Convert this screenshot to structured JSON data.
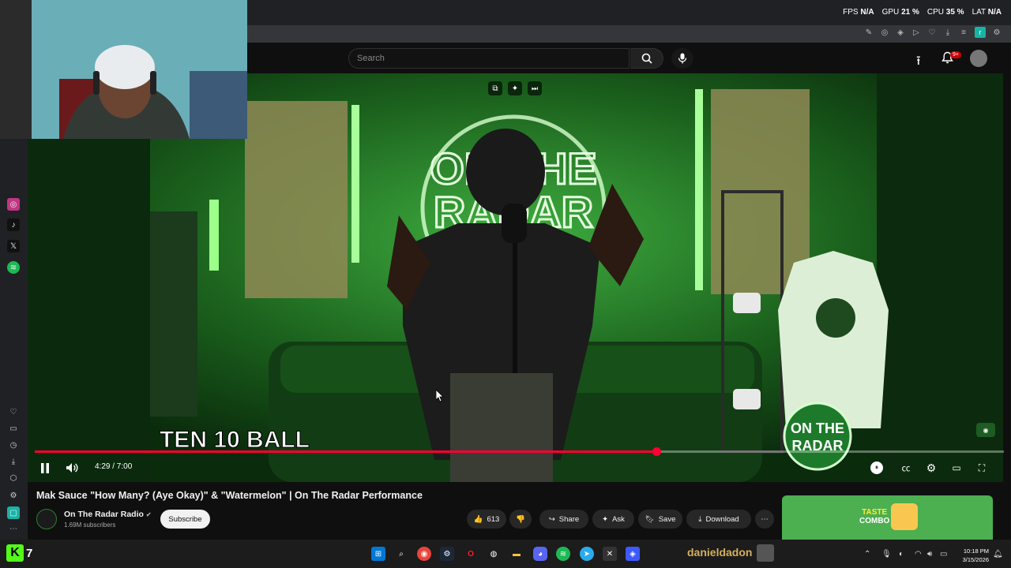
{
  "overlay": {
    "fps_label": "FPS",
    "fps_value": "N/A",
    "gpu_label": "GPU",
    "gpu_value": "21 %",
    "cpu_label": "CPU",
    "cpu_value": "35 %",
    "lat_label": "LAT",
    "lat_value": "N/A"
  },
  "header": {
    "search_placeholder": "Search",
    "notification_count": "9+"
  },
  "player": {
    "current_time": "4:29",
    "duration": "7:00",
    "time_display": "4:29 / 7:00",
    "progress_fraction": 0.641,
    "watermark_left": "TEN 10 BALL",
    "watermark_right_line1": "ON THE",
    "watermark_right_line2": "RADAR",
    "neon_sign_line1": "ON THE",
    "neon_sign_line2": "RADAR"
  },
  "video_info": {
    "title": "Mak Sauce \"How Many? (Aye Okay)\" & \"Watermelon\" | On The Radar Performance",
    "channel_name": "On The Radar Radio",
    "subscribers": "1.69M subscribers",
    "subscribe_label": "Subscribe",
    "like_count": "613",
    "share_label": "Share",
    "ask_label": "Ask",
    "save_label": "Save",
    "download_label": "Download"
  },
  "ad": {
    "line1": "TASTE",
    "line2": "COMBO"
  },
  "taskbar": {
    "kick_number": "7",
    "username": "danieldadon",
    "time": "10:18 PM",
    "date": "3/15/2026"
  },
  "colors": {
    "progress": "#ff0033",
    "neon_green": "#39ff14",
    "page_bg": "#0f0f0f"
  }
}
